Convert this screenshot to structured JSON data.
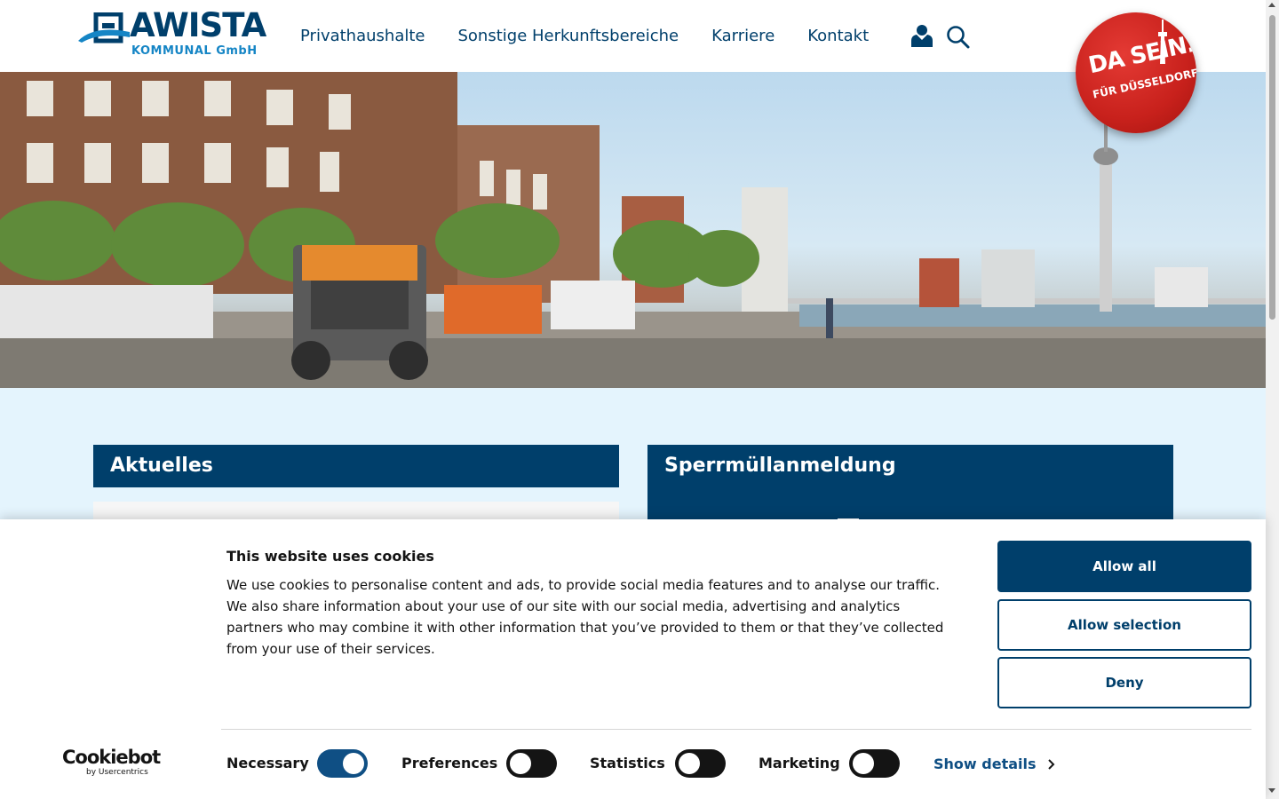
{
  "header": {
    "logo_name": "AWISTA",
    "logo_sub": "KOMMUNAL GmbH",
    "nav": [
      {
        "label": "Privathaushalte"
      },
      {
        "label": "Sonstige Herkunftsbereiche"
      },
      {
        "label": "Karriere"
      },
      {
        "label": "Kontakt"
      }
    ],
    "badge_line1": "DA SEIN.",
    "badge_line2": "FÜR DÜSSELDORF.",
    "icons": {
      "user": "user-icon",
      "search": "search-icon"
    }
  },
  "content": {
    "news_title": "Aktuelles",
    "bulky_title": "Sperrmüllanmeldung"
  },
  "cookie": {
    "title": "This website uses cookies",
    "text": "We use cookies to personalise content and ads, to provide social media features and to analyse our traffic. We also share information about your use of our site with our social media, advertising and analytics partners who may combine it with other information that you’ve provided to them or that they’ve collected from your use of their services.",
    "btn_allow_all": "Allow all",
    "btn_allow_selection": "Allow selection",
    "btn_deny": "Deny",
    "brand_name": "Cookiebot",
    "brand_by": "by Usercentrics",
    "toggles": [
      {
        "label": "Necessary",
        "on": true
      },
      {
        "label": "Preferences",
        "on": false
      },
      {
        "label": "Statistics",
        "on": false
      },
      {
        "label": "Marketing",
        "on": false
      }
    ],
    "show_details": "Show details"
  },
  "colors": {
    "brand_navy": "#003f6b",
    "brand_blue": "#1585c5",
    "content_bg": "#e4f4fd",
    "badge_red": "#c8211c"
  }
}
